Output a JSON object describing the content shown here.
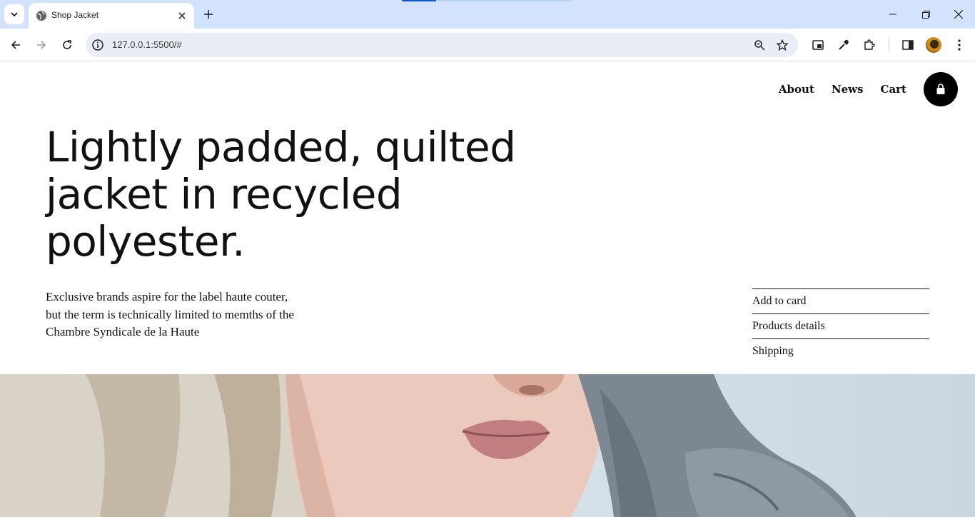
{
  "browser": {
    "tab_title": "Shop Jacket",
    "url": "127.0.0.1:5500/#",
    "icons": [
      "tab-search-icon",
      "globe-favicon-icon",
      "close-icon",
      "plus-icon",
      "minimize-icon",
      "restore-icon",
      "close-window-icon",
      "back-icon",
      "forward-icon",
      "reload-icon",
      "info-icon",
      "zoom-icon",
      "star-icon",
      "picture-in-picture-icon",
      "eyedropper-icon",
      "extensions-icon",
      "sidebar-icon",
      "more-icon"
    ],
    "colors": {
      "tabbar": "#d3e3fd",
      "omnibox": "#e9eef6"
    }
  },
  "site": {
    "nav": {
      "about": "About",
      "news": "News",
      "cart": "Cart"
    },
    "headline": "Lightly padded, quilted jacket in recycled polyester.",
    "intro": "Exclusive brands aspire for the label haute couter, but the term is technically limited to memths of the Chambre Syndicale de la Haute",
    "side_menu": [
      "Add to card",
      "Products details",
      "Shipping"
    ],
    "colors": {
      "text": "#111111",
      "cart_button": "#000000"
    }
  }
}
